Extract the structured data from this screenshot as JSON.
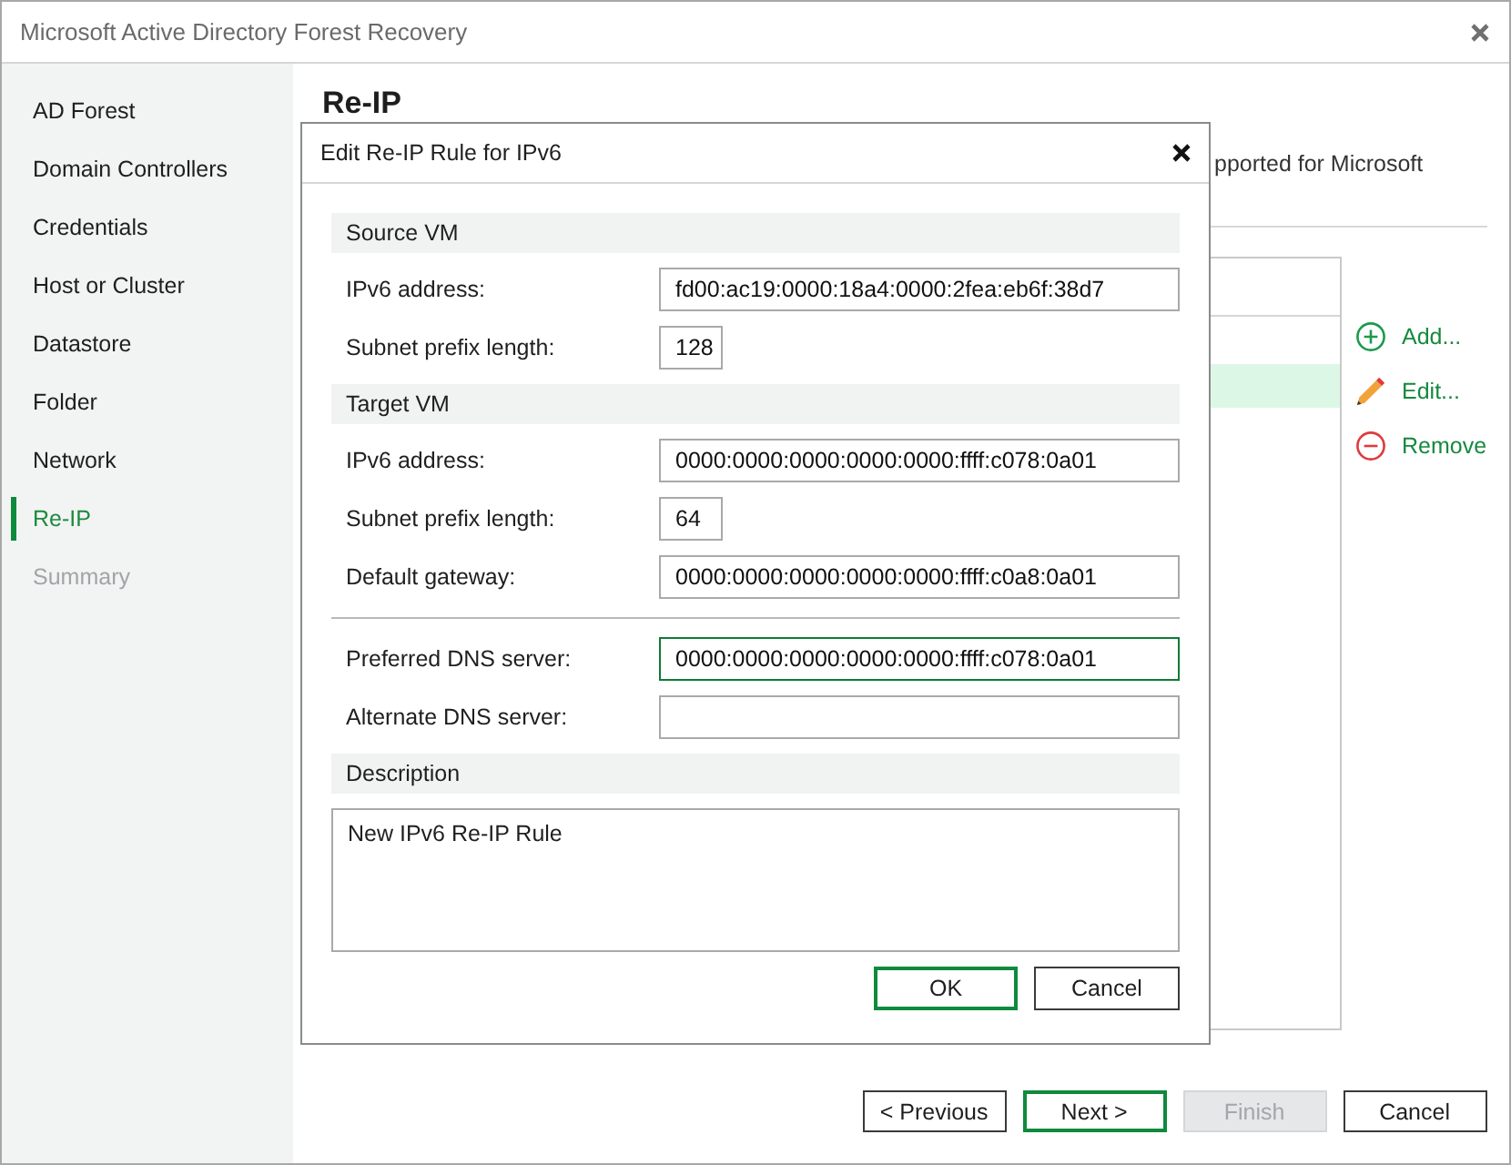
{
  "window": {
    "title": "Microsoft Active Directory Forest Recovery"
  },
  "sidebar": {
    "items": [
      {
        "label": "AD Forest",
        "selected": false,
        "disabled": false
      },
      {
        "label": "Domain Controllers",
        "selected": false,
        "disabled": false
      },
      {
        "label": "Credentials",
        "selected": false,
        "disabled": false
      },
      {
        "label": "Host or Cluster",
        "selected": false,
        "disabled": false
      },
      {
        "label": "Datastore",
        "selected": false,
        "disabled": false
      },
      {
        "label": "Folder",
        "selected": false,
        "disabled": false
      },
      {
        "label": "Network",
        "selected": false,
        "disabled": false
      },
      {
        "label": "Re-IP",
        "selected": true,
        "disabled": false
      },
      {
        "label": "Summary",
        "selected": false,
        "disabled": true
      }
    ]
  },
  "page": {
    "heading": "Re-IP",
    "description": "pported for Microsoft",
    "rules_list": {
      "rows": [
        {
          "selected": false
        },
        {
          "selected": true
        }
      ]
    },
    "actions": [
      {
        "kind": "add",
        "label": "Add..."
      },
      {
        "kind": "edit",
        "label": "Edit..."
      },
      {
        "kind": "remove",
        "label": "Remove"
      }
    ]
  },
  "dialog": {
    "title": "Edit Re-IP Rule for IPv6",
    "sections": [
      {
        "title": "Source VM",
        "field_groups": [
          [
            {
              "kind": "address",
              "label": "IPv6 address:",
              "value": "fd00:ac19:0000:18a4:0000:2fea:eb6f:38d7",
              "focused": false
            },
            {
              "kind": "prefix",
              "label": "Subnet prefix length:",
              "value": "128",
              "focused": false
            }
          ]
        ]
      },
      {
        "title": "Target VM",
        "field_groups": [
          [
            {
              "kind": "address",
              "label": "IPv6 address:",
              "value": "0000:0000:0000:0000:0000:ffff:c078:0a01",
              "focused": false
            },
            {
              "kind": "prefix",
              "label": "Subnet prefix length:",
              "value": "64",
              "focused": false
            },
            {
              "kind": "address",
              "label": "Default gateway:",
              "value": "0000:0000:0000:0000:0000:ffff:c0a8:0a01",
              "focused": false
            }
          ],
          [
            {
              "kind": "address",
              "label": "Preferred DNS server:",
              "value": "0000:0000:0000:0000:0000:ffff:c078:0a01",
              "focused": true
            },
            {
              "kind": "address",
              "label": "Alternate DNS server:",
              "focused": false
            }
          ]
        ]
      },
      {
        "title": "Description",
        "text": "New IPv6 Re-IP Rule"
      }
    ],
    "buttons": [
      {
        "label": "OK",
        "default": true
      },
      {
        "label": "Cancel",
        "default": false
      }
    ]
  },
  "footer_buttons": [
    {
      "label": "< Previous",
      "default": false,
      "disabled": false
    },
    {
      "label": "Next >",
      "default": true,
      "disabled": false
    },
    {
      "label": "Finish",
      "default": false,
      "disabled": true
    },
    {
      "label": "Cancel",
      "default": false,
      "disabled": false
    }
  ]
}
